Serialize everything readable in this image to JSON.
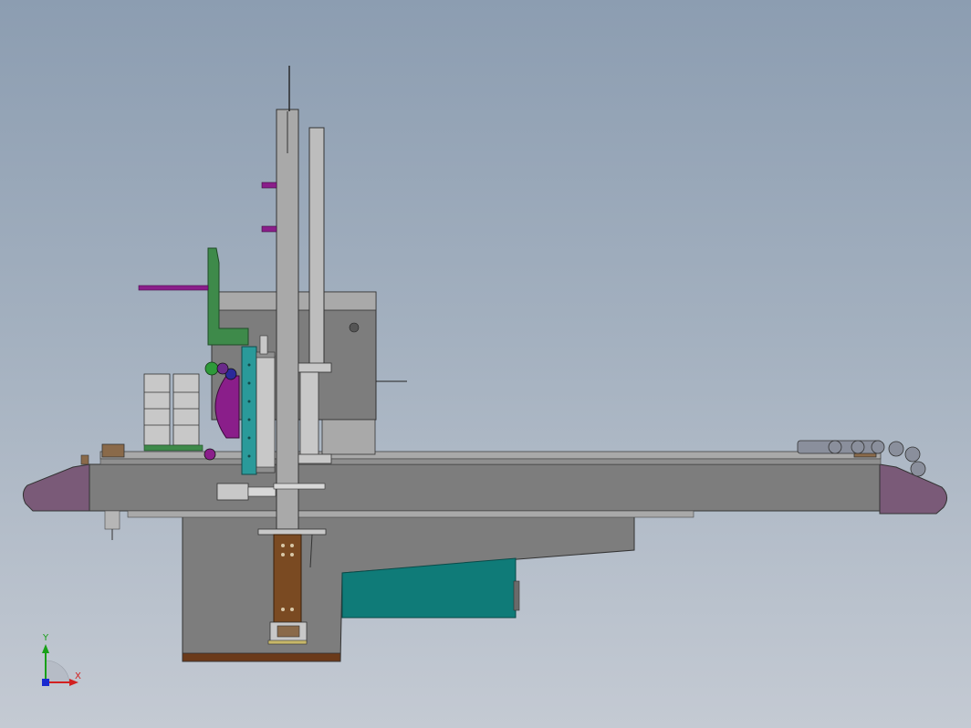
{
  "viewport": {
    "background_top": "#8c9db1",
    "background_bottom": "#c4cad3"
  },
  "triad": {
    "x_label": "X",
    "y_label": "Y",
    "x_color": "#d22020",
    "y_color": "#18a018",
    "z_color": "#1a2ad0"
  },
  "colors": {
    "frame_gray": "#7d7d7d",
    "light_gray": "#a9a9a9",
    "end_cap_purple": "#7a5a78",
    "teal_block": "#0f7b78",
    "brown_plate": "#7a4a22",
    "magenta_part": "#8a1e8a",
    "green_bracket": "#3e8a4a",
    "cyan_plate": "#2a9a9a",
    "cable_chain": "#8a8f9c"
  }
}
